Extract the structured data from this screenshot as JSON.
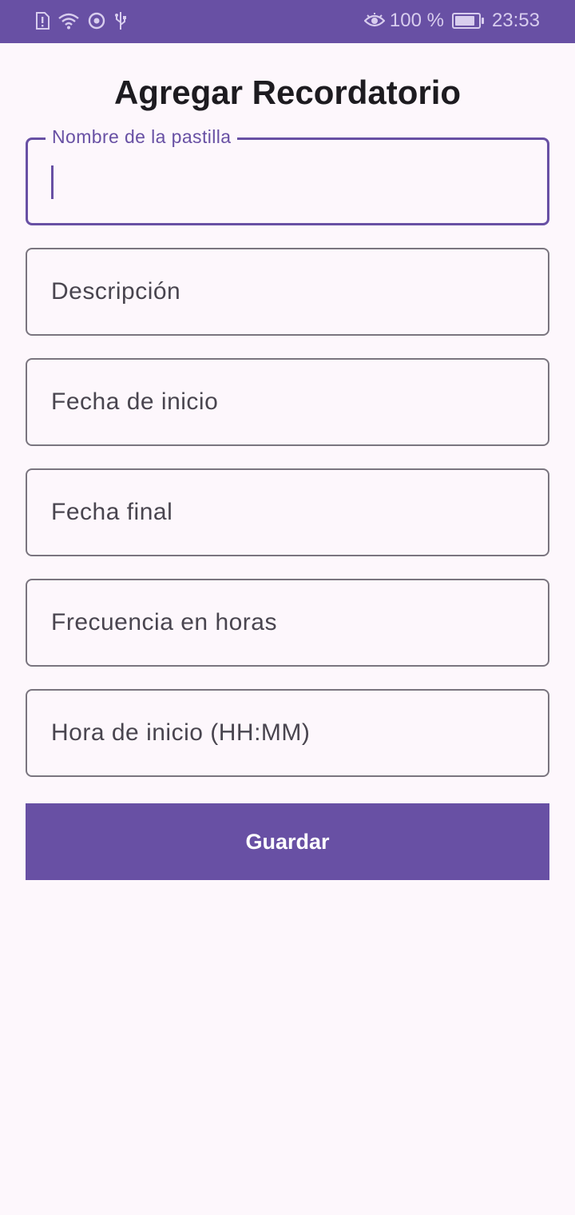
{
  "status_bar": {
    "battery_percent": "100 %",
    "battery_level": 1.0,
    "time": "23:53",
    "icons": [
      "sim-alert-icon",
      "wifi-icon",
      "sync-icon",
      "usb-icon",
      "eye-comfort-icon",
      "battery-charging-icon"
    ],
    "background_color": "#6850a4"
  },
  "screen": {
    "title": "Agregar Recordatorio"
  },
  "form": {
    "pill_name": {
      "label": "Nombre de la pastilla",
      "value": ""
    },
    "description": {
      "placeholder": "Descripción"
    },
    "start_date": {
      "placeholder": "Fecha de inicio"
    },
    "end_date": {
      "placeholder": "Fecha final"
    },
    "frequency": {
      "placeholder": "Frecuencia en horas"
    },
    "start_time": {
      "placeholder": "Hora de inicio (HH:MM)"
    }
  },
  "actions": {
    "save_label": "Guardar"
  },
  "colors": {
    "accent": "#6850a4",
    "background": "#fdf7fc",
    "outline": "#7a757f",
    "text": "#1d1b20"
  }
}
